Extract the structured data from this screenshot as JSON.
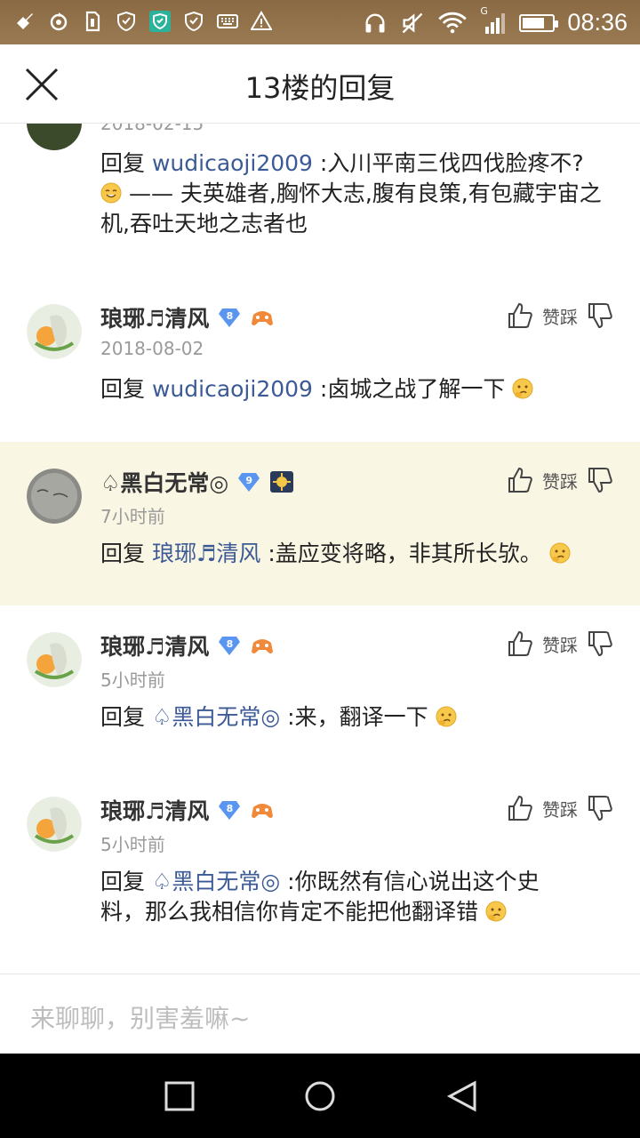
{
  "status_bar": {
    "time": "08:36",
    "network": "G",
    "battery_level": 0.75,
    "left_icons": [
      "settings-tool-icon",
      "sync-icon",
      "sim-card-icon",
      "shield-icon",
      "shield-check-icon",
      "shield-outline-icon",
      "keyboard-icon",
      "warning-icon"
    ],
    "right_icons": [
      "headphones-icon",
      "mute-icon",
      "wifi-icon",
      "signal-icon",
      "battery-icon"
    ]
  },
  "header": {
    "title": "13楼的回复"
  },
  "actions_label": "赞踩",
  "reply_prefix": "回复",
  "comments": [
    {
      "id": "c0",
      "username": "",
      "time": "2018-02-15",
      "mention": "wudicaoji2009",
      "text_before_emoji": " :入川平南三伐四伐脸疼不? ",
      "emoji": "smile-emoji",
      "text_after_emoji": "—— 夫英雄者,胸怀大志,腹有良策,有包藏宇宙之机,吞吐天地之志者也"
    },
    {
      "id": "c1",
      "username": "琅琊♬清风",
      "level": "8",
      "time": "2018-08-02",
      "mention": "wudicaoji2009",
      "text": " :卤城之战了解一下",
      "emoji": "thinking-emoji"
    },
    {
      "id": "c2",
      "username": "♤黑白无常◎",
      "level": "9",
      "time": "7小时前",
      "mention": "琅琊♬清风",
      "text": " :盖应变将略，非其所长欤。",
      "emoji": "thinking-emoji"
    },
    {
      "id": "c3",
      "username": "琅琊♬清风",
      "level": "8",
      "time": "5小时前",
      "mention": "♤黑白无常◎",
      "text": " :来，翻译一下",
      "emoji": "thinking-emoji"
    },
    {
      "id": "c4",
      "username": "琅琊♬清风",
      "level": "8",
      "time": "5小时前",
      "mention": "♤黑白无常◎",
      "text": " :你既然有信心说出这个史料，那么我相信你肯定不能把他翻译错",
      "emoji": "thinking-emoji"
    }
  ],
  "input": {
    "placeholder": "来聊聊，别害羞嘛~"
  },
  "nav": {
    "buttons": [
      "recents-button",
      "home-button",
      "back-button"
    ]
  },
  "colors": {
    "status_bar": "#8a6a44",
    "mention": "#3c5a96",
    "highlight_row": "#faf6e4",
    "level_badge": "#5a96f0",
    "nav_bar": "#000000"
  }
}
